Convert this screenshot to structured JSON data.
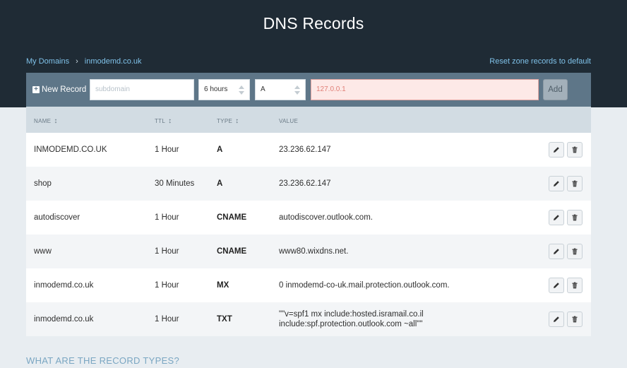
{
  "page": {
    "title": "DNS Records"
  },
  "breadcrumb": {
    "root": "My Domains",
    "separator": "›",
    "current": "inmodemd.co.uk"
  },
  "reset_link": "Reset zone records to default",
  "toolbar": {
    "new_record_label": "New Record",
    "subdomain_placeholder": "subdomain",
    "ttl_value": "6 hours",
    "type_value": "A",
    "value_placeholder": "127.0.0.1",
    "add_label": "Add"
  },
  "table": {
    "headers": {
      "name": "NAME",
      "ttl": "TTL",
      "type": "TYPE",
      "value": "VALUE"
    },
    "rows": [
      {
        "name": "INMODEMD.CO.UK",
        "ttl": "1 Hour",
        "type": "A",
        "value": "23.236.62.147"
      },
      {
        "name": "shop",
        "ttl": "30 Minutes",
        "type": "A",
        "value": "23.236.62.147"
      },
      {
        "name": "autodiscover",
        "ttl": "1 Hour",
        "type": "CNAME",
        "value": "autodiscover.outlook.com."
      },
      {
        "name": "www",
        "ttl": "1 Hour",
        "type": "CNAME",
        "value": "www80.wixdns.net."
      },
      {
        "name": "inmodemd.co.uk",
        "ttl": "1 Hour",
        "type": "MX",
        "value": "0 inmodemd-co-uk.mail.protection.outlook.com."
      },
      {
        "name": "inmodemd.co.uk",
        "ttl": "1 Hour",
        "type": "TXT",
        "value": "\"\"v=spf1 mx include:hosted.isramail.co.il include:spf.protection.outlook.com ~all\"\""
      }
    ]
  },
  "section_heading": "WHAT ARE THE RECORD TYPES?",
  "icons": {
    "edit": "pencil-icon",
    "delete": "trash-icon",
    "add": "plus-icon",
    "sort": "sort-arrow-icon"
  },
  "colors": {
    "header_bg": "#1f2b35",
    "toolbar_bg": "#5e7688",
    "link": "#7fc1e8",
    "error_field": "#fde9e7"
  }
}
